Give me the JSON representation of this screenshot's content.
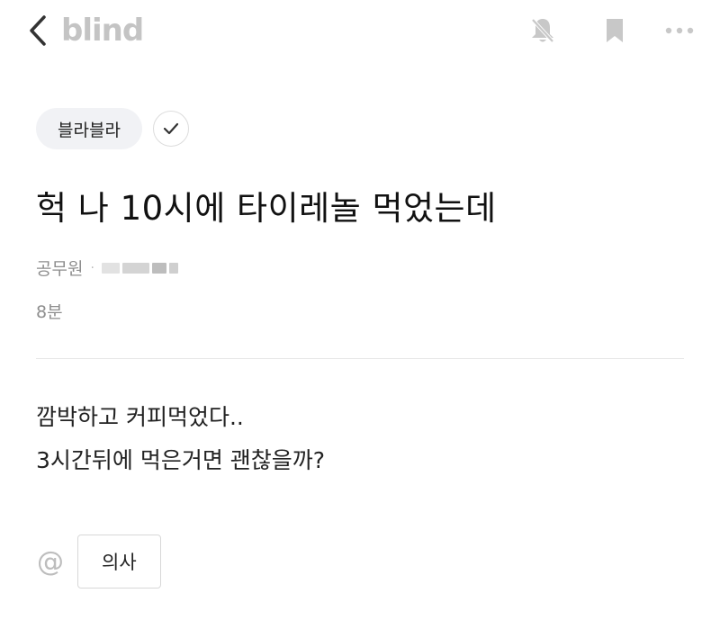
{
  "header": {
    "logo_text": "blind",
    "icons": {
      "back": "chevron-left-icon",
      "notifications": "bell-off-icon",
      "bookmark": "bookmark-icon",
      "more": "more-horizontal-icon"
    }
  },
  "post": {
    "channel": "블라블라",
    "title": "헉 나 10시에 타이레놀 먹었는데",
    "author_company": "공무원",
    "time": "8분",
    "body_lines": [
      "깜박하고 커피먹었다..",
      "3시간뒤에 먹은거면 괜찮을까?"
    ],
    "mention_symbol": "@",
    "mention": "의사"
  },
  "colors": {
    "logo": "#c4c4c4",
    "icon_gray": "#c8c8c8",
    "chip_bg": "#f1f2f5",
    "meta_text": "#8e8e8e",
    "divider": "#e6e6e6"
  }
}
